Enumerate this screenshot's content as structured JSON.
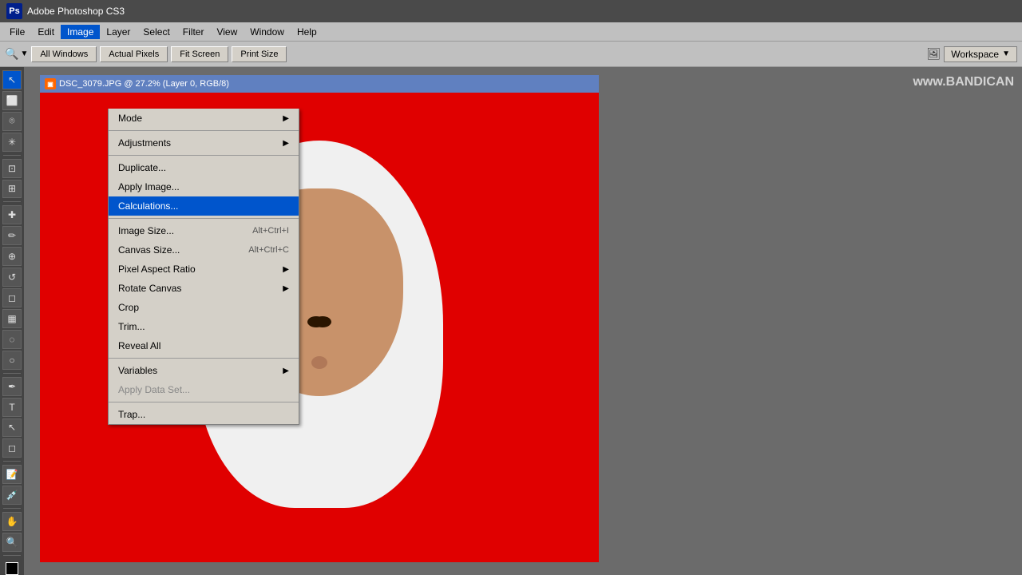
{
  "app": {
    "title": "Adobe Photoshop CS3",
    "ps_label": "Ps"
  },
  "menubar": {
    "items": [
      {
        "id": "file",
        "label": "File"
      },
      {
        "id": "edit",
        "label": "Edit"
      },
      {
        "id": "image",
        "label": "Image",
        "active": true
      },
      {
        "id": "layer",
        "label": "Layer"
      },
      {
        "id": "select",
        "label": "Select"
      },
      {
        "id": "filter",
        "label": "Filter"
      },
      {
        "id": "view",
        "label": "View"
      },
      {
        "id": "window",
        "label": "Window"
      },
      {
        "id": "help",
        "label": "Help"
      }
    ]
  },
  "toolbar": {
    "buttons": [
      {
        "id": "all-windows",
        "label": "All Windows"
      },
      {
        "id": "actual-pixels",
        "label": "Actual Pixels"
      },
      {
        "id": "fit-screen",
        "label": "Fit Screen"
      },
      {
        "id": "print-size",
        "label": "Print Size"
      }
    ],
    "workspace_label": "Workspace"
  },
  "image_menu": {
    "items": [
      {
        "id": "mode",
        "label": "Mode",
        "has_arrow": true,
        "shortcut": ""
      },
      {
        "id": "sep1",
        "type": "separator"
      },
      {
        "id": "adjustments",
        "label": "Adjustments",
        "has_arrow": true,
        "shortcut": ""
      },
      {
        "id": "sep2",
        "type": "separator"
      },
      {
        "id": "duplicate",
        "label": "Duplicate...",
        "has_arrow": false,
        "shortcut": ""
      },
      {
        "id": "apply-image",
        "label": "Apply Image...",
        "has_arrow": false,
        "shortcut": ""
      },
      {
        "id": "calculations",
        "label": "Calculations...",
        "has_arrow": false,
        "shortcut": "",
        "highlighted": true
      },
      {
        "id": "sep3",
        "type": "separator"
      },
      {
        "id": "image-size",
        "label": "Image Size...",
        "has_arrow": false,
        "shortcut": "Alt+Ctrl+I"
      },
      {
        "id": "canvas-size",
        "label": "Canvas Size...",
        "has_arrow": false,
        "shortcut": "Alt+Ctrl+C"
      },
      {
        "id": "pixel-aspect",
        "label": "Pixel Aspect Ratio",
        "has_arrow": true,
        "shortcut": ""
      },
      {
        "id": "rotate-canvas",
        "label": "Rotate Canvas",
        "has_arrow": true,
        "shortcut": ""
      },
      {
        "id": "crop",
        "label": "Crop",
        "has_arrow": false,
        "shortcut": ""
      },
      {
        "id": "trim",
        "label": "Trim...",
        "has_arrow": false,
        "shortcut": ""
      },
      {
        "id": "reveal-all",
        "label": "Reveal All",
        "has_arrow": false,
        "shortcut": ""
      },
      {
        "id": "sep4",
        "type": "separator"
      },
      {
        "id": "variables",
        "label": "Variables",
        "has_arrow": true,
        "shortcut": ""
      },
      {
        "id": "apply-data",
        "label": "Apply Data Set...",
        "has_arrow": false,
        "shortcut": "",
        "disabled": true
      },
      {
        "id": "sep5",
        "type": "separator"
      },
      {
        "id": "trap",
        "label": "Trap...",
        "has_arrow": false,
        "shortcut": ""
      }
    ]
  },
  "image_window": {
    "title": "DSC_3079.JPG @ 27.2% (Layer 0, RGB/8)"
  },
  "watermark": "www.BANDICAN"
}
